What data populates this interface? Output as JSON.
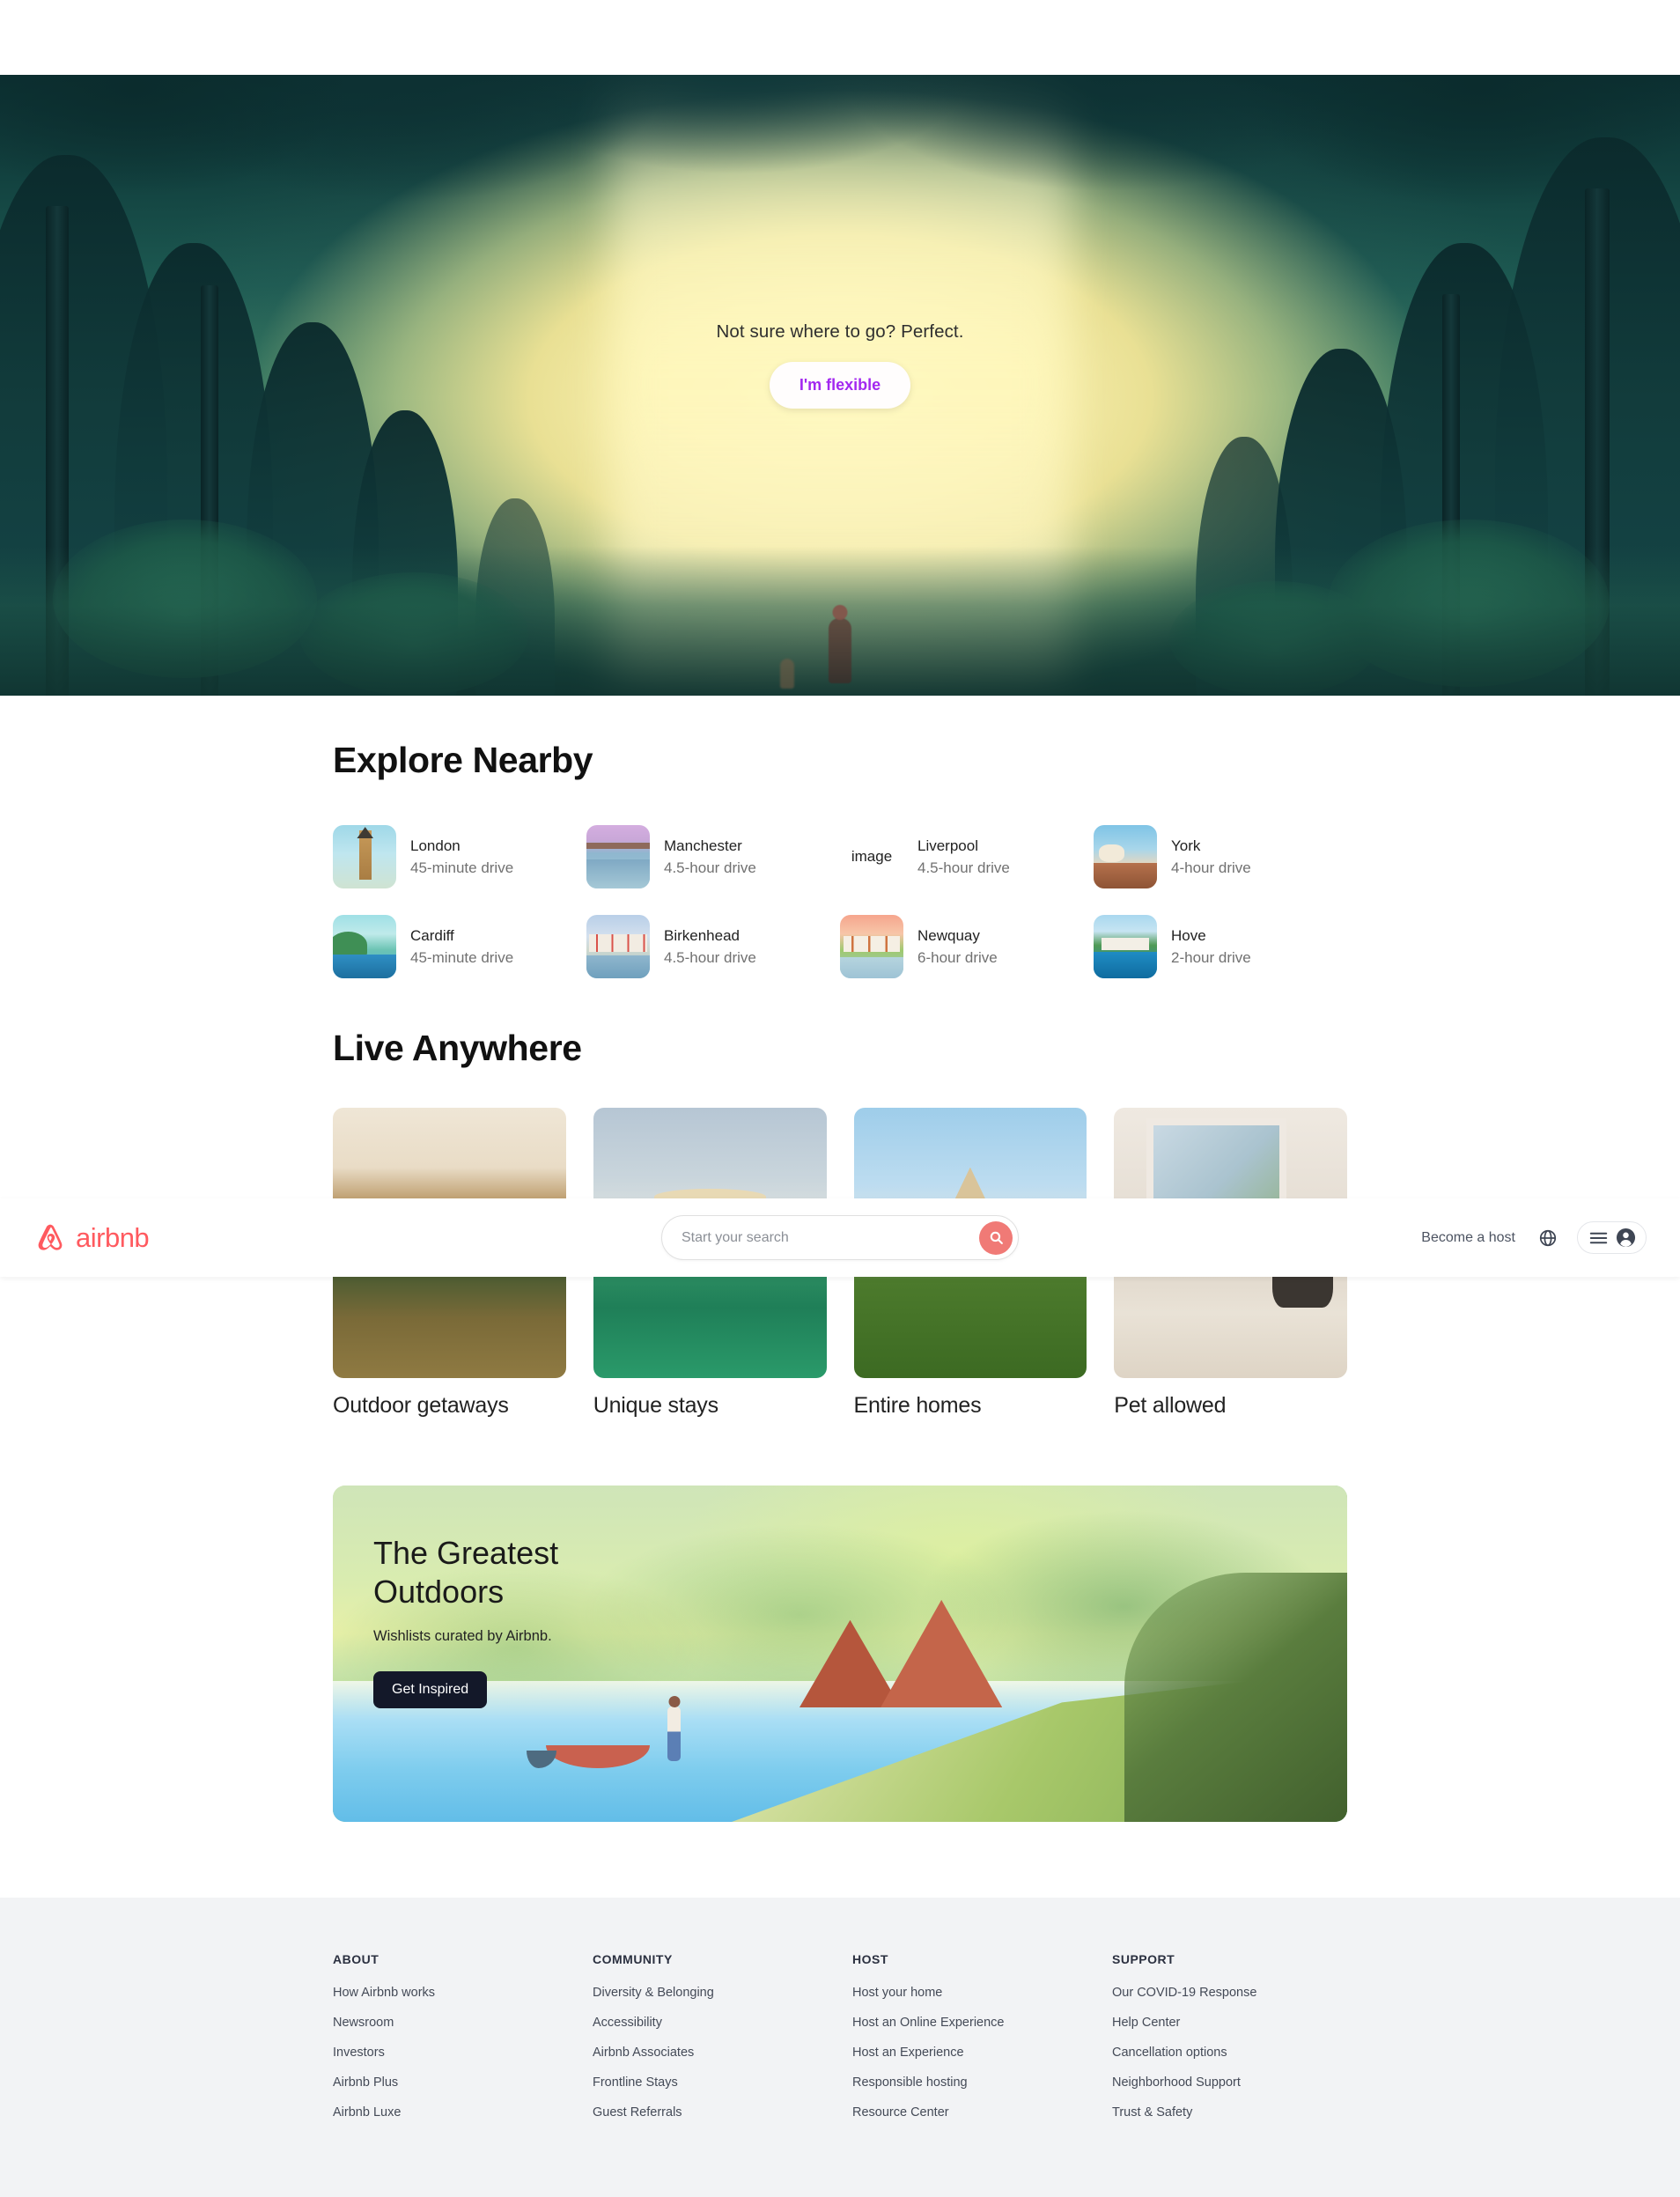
{
  "hero": {
    "tagline": "Not sure where to go? Perfect.",
    "cta_label": "I'm flexible",
    "cta_color": "#a328f0"
  },
  "header": {
    "brand_name": "airbnb",
    "brand_color": "#ff5a5f",
    "search_placeholder": "Start your search",
    "search_value": "",
    "become_host_label": "Become a host",
    "globe_icon": "globe-icon",
    "menu_icon": "hamburger-menu-icon",
    "avatar_icon": "user-avatar-icon",
    "search_icon": "search-icon"
  },
  "explore": {
    "title": "Explore Nearby",
    "cities": [
      {
        "name": "London",
        "distance": "45-minute drive",
        "art": "t-london",
        "broken": false,
        "alt": "image"
      },
      {
        "name": "Manchester",
        "distance": "4.5-hour drive",
        "art": "t-manchester",
        "broken": false,
        "alt": "image"
      },
      {
        "name": "Liverpool",
        "distance": "4.5-hour drive",
        "art": "t-liverpool",
        "broken": true,
        "alt": "image"
      },
      {
        "name": "York",
        "distance": "4-hour drive",
        "art": "t-york",
        "broken": false,
        "alt": "image"
      },
      {
        "name": "Cardiff",
        "distance": "45-minute drive",
        "art": "t-cardiff",
        "broken": false,
        "alt": "image"
      },
      {
        "name": "Birkenhead",
        "distance": "4.5-hour drive",
        "art": "t-birkenhead",
        "broken": false,
        "alt": "image"
      },
      {
        "name": "Newquay",
        "distance": "6-hour drive",
        "art": "t-newquay",
        "broken": false,
        "alt": "image"
      },
      {
        "name": "Hove",
        "distance": "2-hour drive",
        "art": "t-hove",
        "broken": false,
        "alt": "image"
      }
    ]
  },
  "live": {
    "title": "Live Anywhere",
    "cards": [
      {
        "caption": "Outdoor getaways",
        "art": "a-outdoor"
      },
      {
        "caption": "Unique stays",
        "art": "a-unique"
      },
      {
        "caption": "Entire homes",
        "art": "a-entire"
      },
      {
        "caption": "Pet allowed",
        "art": "a-pet"
      }
    ]
  },
  "promo": {
    "title": "The Greatest Outdoors",
    "subtitle": "Wishlists curated by Airbnb.",
    "button_label": "Get Inspired",
    "button_bg": "#131829"
  },
  "footer": {
    "columns": [
      {
        "heading": "ABOUT",
        "links": [
          "How Airbnb works",
          "Newsroom",
          "Investors",
          "Airbnb Plus",
          "Airbnb Luxe"
        ]
      },
      {
        "heading": "COMMUNITY",
        "links": [
          "Diversity & Belonging",
          "Accessibility",
          "Airbnb Associates",
          "Frontline Stays",
          "Guest Referrals"
        ]
      },
      {
        "heading": "HOST",
        "links": [
          "Host your home",
          "Host an Online Experience",
          "Host an Experience",
          "Responsible hosting",
          "Resource Center"
        ]
      },
      {
        "heading": "SUPPORT",
        "links": [
          "Our COVID-19 Response",
          "Help Center",
          "Cancellation options",
          "Neighborhood Support",
          "Trust & Safety"
        ]
      }
    ]
  }
}
